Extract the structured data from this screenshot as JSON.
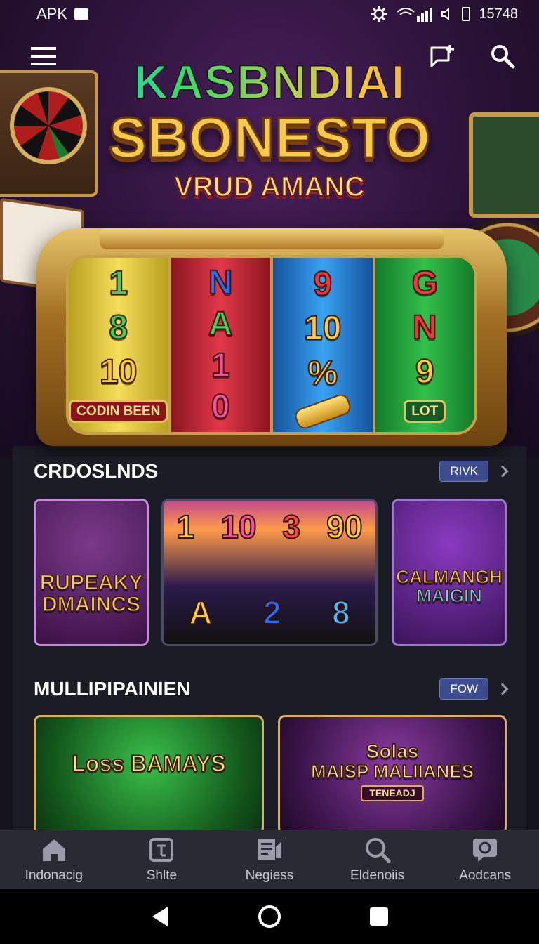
{
  "status_bar": {
    "left_text": "APK",
    "right_text": "15748"
  },
  "hero": {
    "title_line1": "KASBNDIAI",
    "title_line2": "SBONESTO",
    "title_line3": "VRUD AMANC"
  },
  "slot_machine": {
    "reel1": {
      "symbols": [
        "1",
        "8",
        "10"
      ],
      "plate": "CODIN BEEN"
    },
    "reel2": {
      "symbols": [
        "N",
        "A",
        "1",
        "0"
      ]
    },
    "reel3": {
      "symbols": [
        "9",
        "10",
        "%"
      ]
    },
    "reel4": {
      "symbols": [
        "G",
        "N",
        "9"
      ],
      "plate": "LOT"
    }
  },
  "section1": {
    "title": "CRDOSLNDS",
    "pill": "RIVK",
    "tiles": [
      {
        "label": "RUPEAKY DMAINCS"
      },
      {
        "top_numbers": [
          "1",
          "10",
          "3",
          "90"
        ],
        "bottom_numbers": [
          "A",
          "2",
          "8"
        ]
      },
      {
        "line1": "CALMANGH",
        "line2": "MAIGIN"
      }
    ]
  },
  "section2": {
    "title": "MULLIPIPAINIEN",
    "pill": "FOW",
    "tiles": [
      {
        "label": "Loss BAMAYS"
      },
      {
        "line1": "Solas",
        "line2": "MAISP MALIIANES",
        "tag": "TENEADJ"
      }
    ]
  },
  "bottom_nav": [
    {
      "label": "Indonacig",
      "icon": "home-icon"
    },
    {
      "label": "Shlte",
      "icon": "tablet-icon"
    },
    {
      "label": "Negiess",
      "icon": "news-icon"
    },
    {
      "label": "Eldenoiis",
      "icon": "search-icon"
    },
    {
      "label": "Aodcans",
      "icon": "chat-icon"
    }
  ],
  "colors": {
    "accent": "#3c4c8e",
    "background": "#14121c",
    "panel": "#1c1c26",
    "gold": "#f7c94a"
  }
}
